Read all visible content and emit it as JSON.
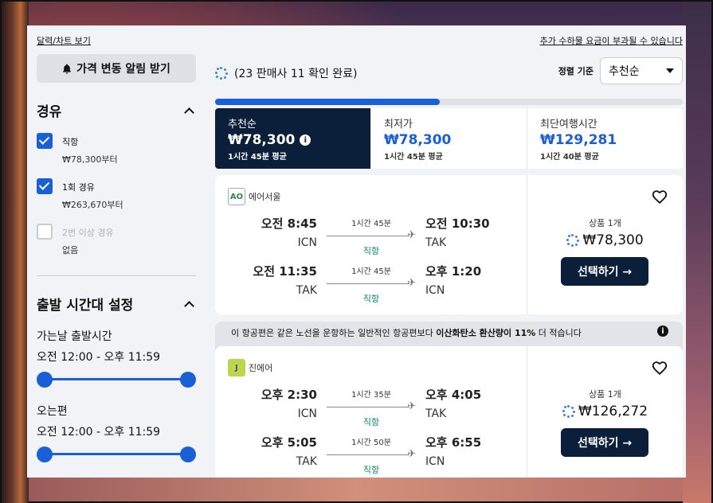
{
  "top_links": {
    "calendar": "달력/차트 보기",
    "fees": "추가 수하물 요금이 부과될 수 있습니다"
  },
  "sidebar": {
    "alert_button": "가격 변동 알림 받기",
    "stops": {
      "title": "경유",
      "options": [
        {
          "label": "직항",
          "sub": "₩78,300부터",
          "checked": true
        },
        {
          "label": "1회 경유",
          "sub": "₩263,670부터",
          "checked": true
        },
        {
          "label": "2번 이상 경유",
          "sub": "없음",
          "checked": false
        }
      ]
    },
    "departure_time": {
      "title": "출발 시간대 설정",
      "outbound_label": "가는날 출발시간",
      "outbound_range": "오전 12:00 - 오후 11:59",
      "return_label": "오는편",
      "return_range": "오전 12:00 - 오후 11:59"
    }
  },
  "main": {
    "status": "(23 판매사 11 확인 완료)",
    "sort_label": "정렬 기준",
    "sort_value": "추천순",
    "progress": 0.48,
    "sort_tabs": [
      {
        "title": "추천순",
        "price": "₩78,300",
        "duration": "1시간 45분 평균"
      },
      {
        "title": "최저가",
        "price": "₩78,300",
        "duration": "1시간 45분 평균"
      },
      {
        "title": "최단여행시간",
        "price": "₩129,281",
        "duration": "1시간 40분 평균"
      }
    ],
    "eco_banner": {
      "pre": "이 항공편은 같은 노선을 운항하는 일반적인 항공편보다 ",
      "bold": "이산화탄소 환산량이 11%",
      "post": " 더 적습니다"
    },
    "flights": [
      {
        "airline": "에어서울",
        "legs": [
          {
            "dep_time": "오전 8:45",
            "dep_code": "ICN",
            "duration": "1시간 45분",
            "stops": "직항",
            "arr_time": "오전 10:30",
            "arr_code": "TAK"
          },
          {
            "dep_time": "오전 11:35",
            "dep_code": "TAK",
            "duration": "1시간 45분",
            "stops": "직항",
            "arr_time": "오후 1:20",
            "arr_code": "ICN"
          }
        ],
        "offer_count": "상품 1개",
        "price": "₩78,300",
        "select": "선택하기 →"
      },
      {
        "airline": "진에어",
        "legs": [
          {
            "dep_time": "오후 2:30",
            "dep_code": "ICN",
            "duration": "1시간 35분",
            "stops": "직항",
            "arr_time": "오후 4:05",
            "arr_code": "TAK"
          },
          {
            "dep_time": "오후 5:05",
            "dep_code": "TAK",
            "duration": "1시간 50분",
            "stops": "직항",
            "arr_time": "오후 6:55",
            "arr_code": "ICN"
          }
        ],
        "offer_count": "상품 1개",
        "price": "₩126,272",
        "select": "선택하기 →"
      }
    ]
  },
  "colors": {
    "accent": "#1a5fd6",
    "navy": "#0b1f3a",
    "green": "#0a8a5a"
  }
}
